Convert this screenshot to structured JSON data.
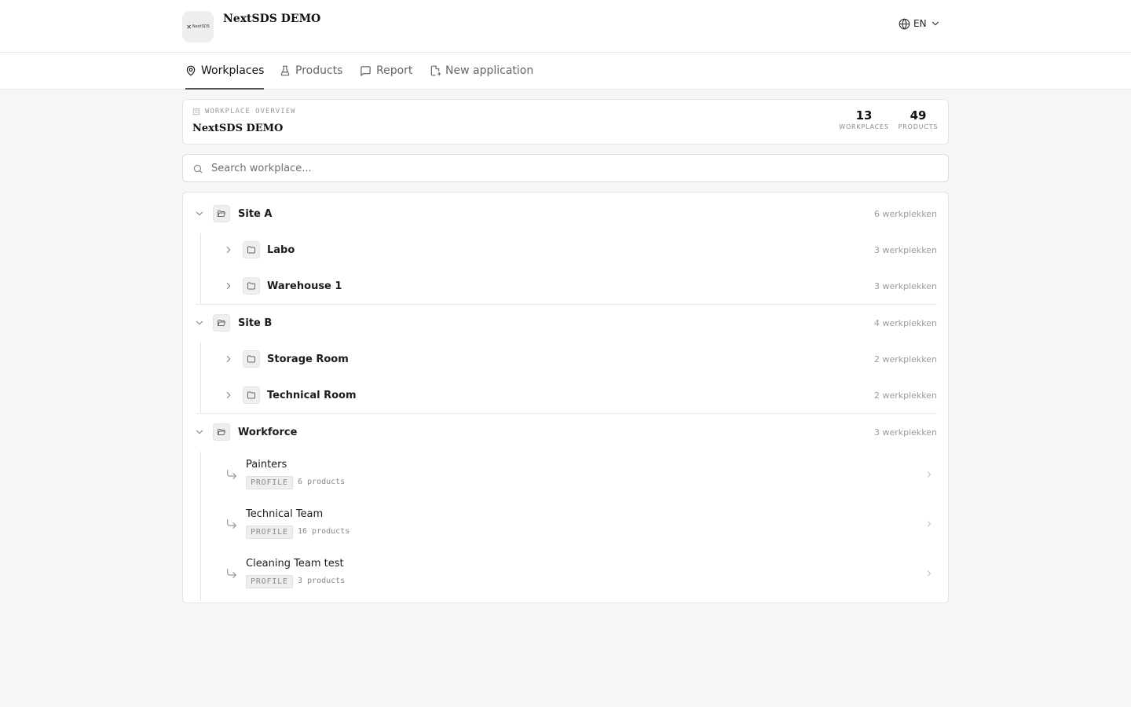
{
  "header": {
    "logo_mark": "✕",
    "logo_text": "NextSDS",
    "app_title": "NextSDS DEMO",
    "language": "EN"
  },
  "nav": {
    "tabs": [
      {
        "label": "Workplaces",
        "icon": "map-pin-icon",
        "active": true
      },
      {
        "label": "Products",
        "icon": "flask-icon",
        "active": false
      },
      {
        "label": "Report",
        "icon": "message-square-icon",
        "active": false
      },
      {
        "label": "New application",
        "icon": "file-plus-icon",
        "active": false
      }
    ]
  },
  "overview": {
    "kicker": "WORKPLACE OVERVIEW",
    "title": "NextSDS DEMO",
    "stats": [
      {
        "value": "13",
        "label": "WORKPLACES"
      },
      {
        "value": "49",
        "label": "PRODUCTS"
      }
    ]
  },
  "search": {
    "placeholder": "Search workplace...",
    "value": ""
  },
  "tree": {
    "groups": [
      {
        "label": "Site A",
        "count": "6 werkplekken",
        "expanded": true,
        "children": [
          {
            "label": "Labo",
            "count": "3 werkplekken"
          },
          {
            "label": "Warehouse 1",
            "count": "3 werkplekken"
          }
        ]
      },
      {
        "label": "Site B",
        "count": "4 werkplekken",
        "expanded": true,
        "children": [
          {
            "label": "Storage Room",
            "count": "2 werkplekken"
          },
          {
            "label": "Technical Room",
            "count": "2 werkplekken"
          }
        ]
      },
      {
        "label": "Workforce",
        "count": "3 werkplekken",
        "expanded": true,
        "profiles": [
          {
            "name": "Painters",
            "badge": "PROFILE",
            "count": "6 products"
          },
          {
            "name": "Technical Team",
            "badge": "PROFILE",
            "count": "16 products"
          },
          {
            "name": "Cleaning Team test",
            "badge": "PROFILE",
            "count": "3 products"
          }
        ]
      }
    ]
  },
  "colors": {
    "background": "#f6f6f6",
    "surface": "#ffffff",
    "border": "#e3e3e3",
    "text": "#1c1c1c",
    "muted": "#9a9a9a",
    "active_tab_underline": "#555555"
  }
}
